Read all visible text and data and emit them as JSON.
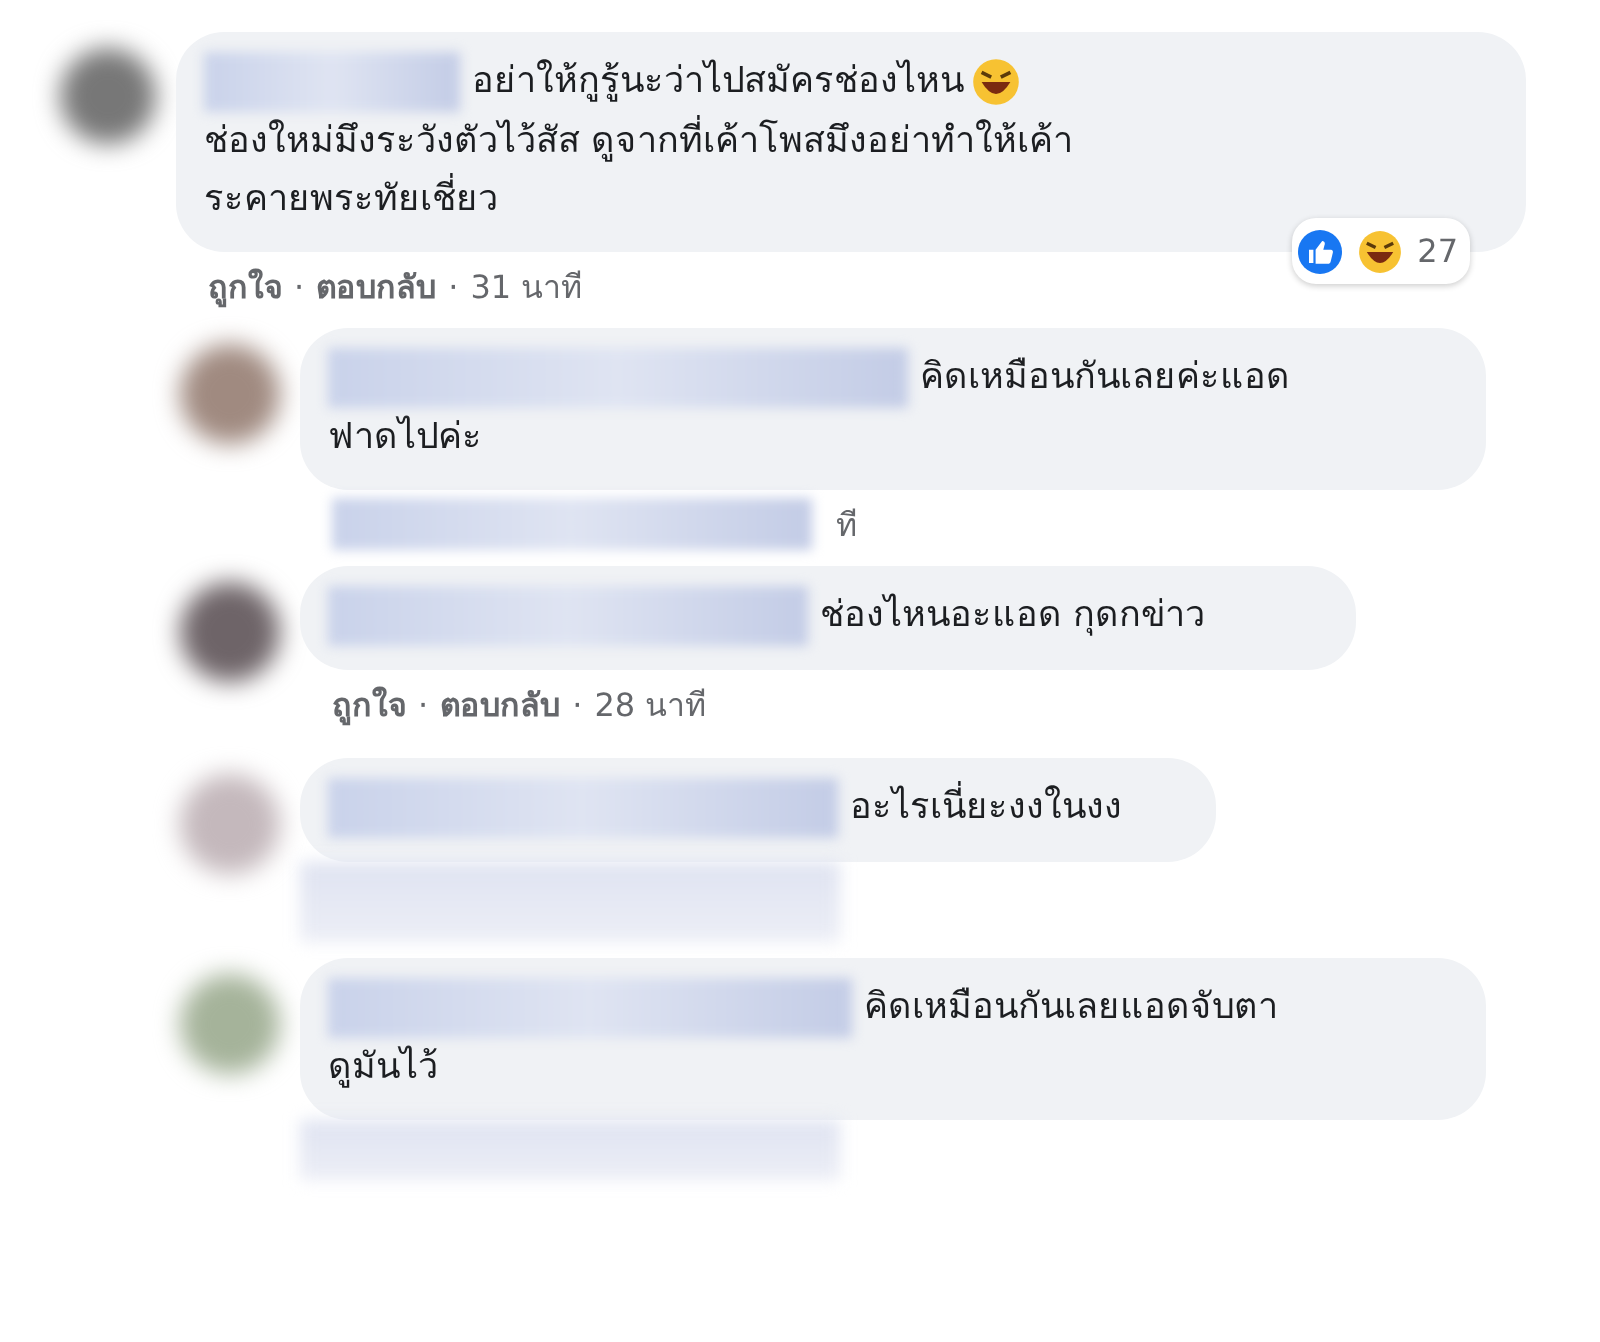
{
  "comments": [
    {
      "segments": [
        {
          "kind": "text",
          "text": "อย่าให้กูรู้นะว่าไปสมัครช่องไหน"
        },
        {
          "kind": "emoji"
        },
        {
          "kind": "break"
        },
        {
          "kind": "text",
          "text": "ช่องใหม่มึงระวังตัวไว้สัส ดูจากที่เค้าโพสมึงอย่าทำให้เค้า"
        },
        {
          "kind": "break"
        },
        {
          "kind": "text",
          "text": "ระคายพระทัยเชี่ยว"
        }
      ],
      "reactions": {
        "types": [
          {
            "kind": "like"
          },
          {
            "kind": "haha"
          }
        ],
        "count": "27"
      },
      "meta": {
        "like": "ถูกใจ",
        "sep1": "·",
        "reply": "ตอบกลับ",
        "sep2": "·",
        "time": "31 นาที"
      },
      "children": [
        {
          "segments": [
            {
              "kind": "text",
              "text": "คิดเหมือนกันเลยค่ะแอด"
            },
            {
              "kind": "break"
            },
            {
              "kind": "text",
              "text": "ฟาดไปค่ะ"
            }
          ],
          "meta_tail": "ที"
        },
        {
          "segments": [
            {
              "kind": "text",
              "text": "ช่องไหนอะแอด กุดกข่าว"
            }
          ],
          "meta": {
            "like": "ถูกใจ",
            "sep1": "·",
            "reply": "ตอบกลับ",
            "sep2": "·",
            "time": "28 นาที"
          }
        },
        {
          "segments": [
            {
              "kind": "text",
              "text": "อะไรเนี่ยะงงในงง"
            }
          ]
        },
        {
          "segments": [
            {
              "kind": "text",
              "text": "คิดเหมือนกันเลยแอดจับตา"
            },
            {
              "kind": "break"
            },
            {
              "kind": "text",
              "text": "ดูมันไว้"
            }
          ]
        }
      ]
    }
  ]
}
